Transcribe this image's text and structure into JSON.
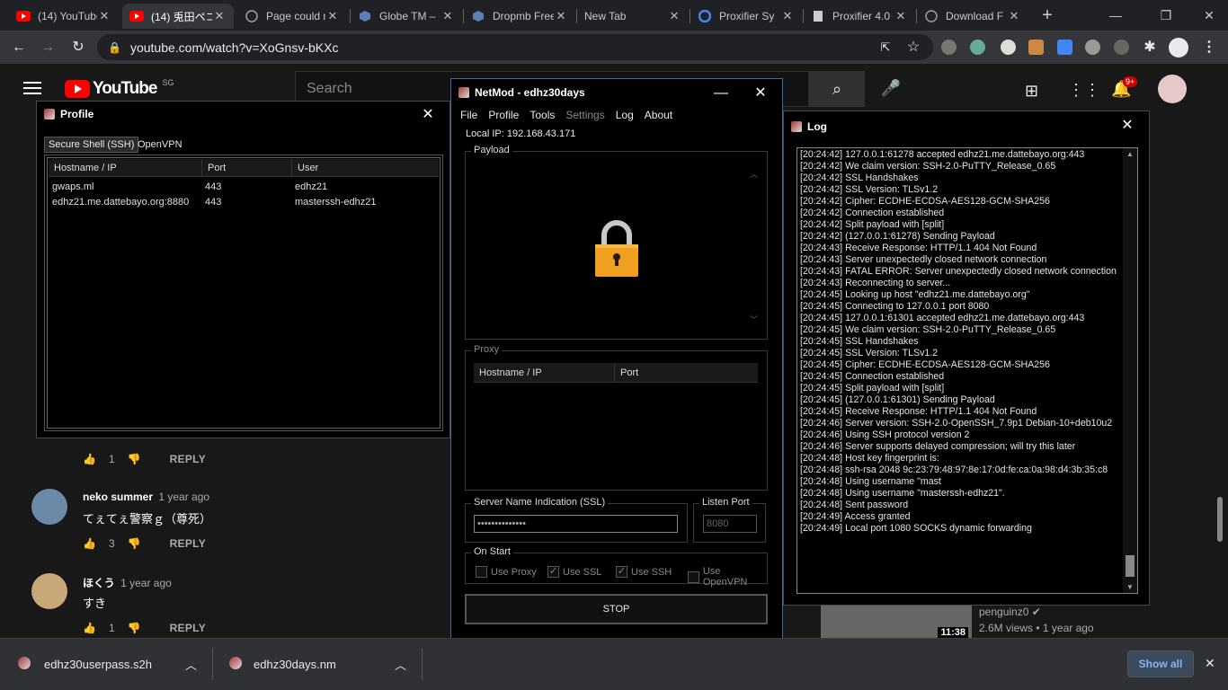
{
  "browser": {
    "tabs": [
      {
        "title": "(14) YouTube",
        "favicon": "youtube-icon"
      },
      {
        "title": "(14) 兎田ペコラ",
        "favicon": "youtube-icon"
      },
      {
        "title": "Page could not",
        "favicon": "globe-icon"
      },
      {
        "title": "Globe TM –",
        "favicon": "cube-icon"
      },
      {
        "title": "Dropmb Free",
        "favicon": "cube-icon"
      },
      {
        "title": "New Tab",
        "favicon": ""
      },
      {
        "title": "Proxifier Sy",
        "favicon": "google-icon"
      },
      {
        "title": "Proxifier 4.0",
        "favicon": "file-icon"
      },
      {
        "title": "Download F",
        "favicon": "globe-icon"
      }
    ],
    "new_tab": "+",
    "url": "youtube.com/watch?v=XoGnsv-bKXc"
  },
  "youtube": {
    "logo": "YouTube",
    "region": "SG",
    "search_placeholder": "Search",
    "notif_count": "9+",
    "comments": [
      {
        "author": "",
        "time": "",
        "text": "",
        "likes": "1",
        "reply": "REPLY"
      },
      {
        "author": "neko summer",
        "time": "1 year ago",
        "text": "てぇてぇ警察ｇ（尊死）",
        "likes": "3",
        "reply": "REPLY"
      },
      {
        "author": "ほくう",
        "time": "1 year ago",
        "text": "すき",
        "likes": "1",
        "reply": "REPLY"
      }
    ],
    "side_video": {
      "channel": "penguinz0",
      "meta": "2.6M views • 1 year ago",
      "duration": "11:38"
    }
  },
  "profile_window": {
    "title": "Profile",
    "tabs": [
      "Secure Shell (SSH)",
      "OpenVPN"
    ],
    "columns": [
      "Hostname / IP",
      "Port",
      "User"
    ],
    "rows": [
      [
        "gwaps.ml",
        "443",
        "edhz21"
      ],
      [
        "edhz21.me.dattebayo.org:8880",
        "443",
        "masterssh-edhz21"
      ]
    ]
  },
  "netmod_window": {
    "title": "NetMod - edhz30days",
    "menu": [
      "File",
      "Profile",
      "Tools",
      "Settings",
      "Log",
      "About"
    ],
    "local_ip_label": "Local IP: 192.168.43.171",
    "payload_label": "Payload",
    "proxy_label": "Proxy",
    "proxy_columns": [
      "Hostname / IP",
      "Port"
    ],
    "sni_label": "Server Name Indication (SSL)",
    "sni_value": "••••••••••••••",
    "listen_port_label": "Listen Port",
    "listen_port_value": "8080",
    "on_start_label": "On Start",
    "options": [
      {
        "label": "Use Proxy",
        "checked": false
      },
      {
        "label": "Use SSL",
        "checked": true
      },
      {
        "label": "Use SSH",
        "checked": true
      },
      {
        "label": "Use OpenVPN",
        "checked": false
      }
    ],
    "stop_button": "STOP"
  },
  "log_window": {
    "title": "Log",
    "lines": [
      "[20:24:42] 127.0.0.1:61278 accepted edhz21.me.dattebayo.org:443",
      "[20:24:42] We claim version: SSH-2.0-PuTTY_Release_0.65",
      "[20:24:42] SSL Handshakes",
      "[20:24:42] SSL Version: TLSv1.2",
      "[20:24:42] Cipher: ECDHE-ECDSA-AES128-GCM-SHA256",
      "[20:24:42] Connection established",
      "[20:24:42] Split payload with [split]",
      "[20:24:42] (127.0.0.1:61278) Sending Payload",
      "[20:24:43] Receive Response: HTTP/1.1 404 Not Found",
      "[20:24:43] Server unexpectedly closed network connection",
      "[20:24:43] FATAL ERROR: Server unexpectedly closed network connection",
      "[20:24:43] Reconnecting to server...",
      "[20:24:45] Looking up host \"edhz21.me.dattebayo.org\"",
      "[20:24:45] Connecting to 127.0.0.1 port 8080",
      "[20:24:45] 127.0.0.1:61301 accepted edhz21.me.dattebayo.org:443",
      "[20:24:45] We claim version: SSH-2.0-PuTTY_Release_0.65",
      "[20:24:45] SSL Handshakes",
      "[20:24:45] SSL Version: TLSv1.2",
      "[20:24:45] Cipher: ECDHE-ECDSA-AES128-GCM-SHA256",
      "[20:24:45] Connection established",
      "[20:24:45] Split payload with [split]",
      "[20:24:45] (127.0.0.1:61301) Sending Payload",
      "[20:24:45] Receive Response: HTTP/1.1 404 Not Found",
      "[20:24:46] Server version: SSH-2.0-OpenSSH_7.9p1 Debian-10+deb10u2",
      "[20:24:46] Using SSH protocol version 2",
      "[20:24:46] Server supports delayed compression; will try this later",
      "[20:24:48] Host key fingerprint is:",
      "[20:24:48] ssh-rsa 2048 9c:23:79:48:97:8e:17:0d:fe:ca:0a:98:d4:3b:35:c8",
      "[20:24:48] Using username \"mast",
      "[20:24:48] Using username \"masterssh-edhz21\".",
      "[20:24:48] Sent password",
      "[20:24:49] Access granted",
      "[20:24:49] Local port 1080 SOCKS dynamic forwarding"
    ]
  },
  "downloads": {
    "items": [
      {
        "name": "edhz30userpass.s2h"
      },
      {
        "name": "edhz30days.nm"
      }
    ],
    "show_all": "Show all"
  },
  "colors": {
    "youtube_red": "#ff0000",
    "lock_gold": "#f0a020",
    "tab_active": "#35363a"
  }
}
